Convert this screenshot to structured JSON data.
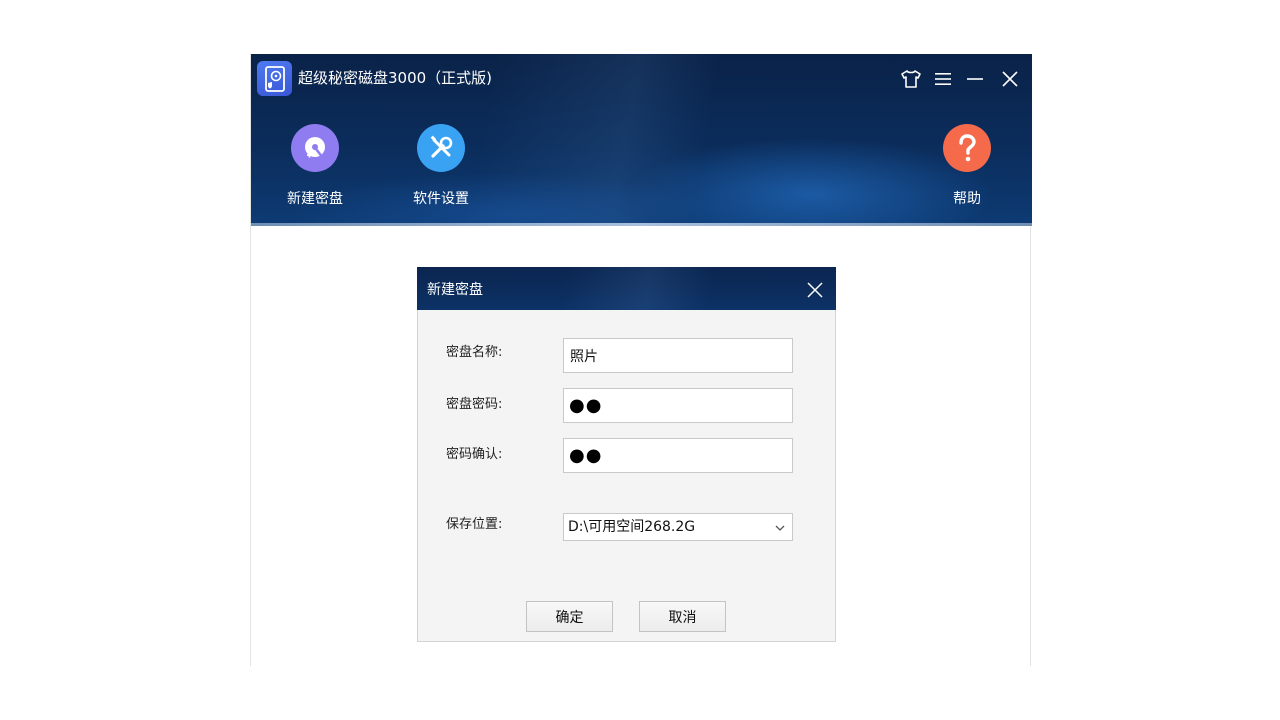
{
  "window": {
    "title": "超级秘密磁盘3000（正式版)"
  },
  "window_controls": {
    "skin_icon": "tshirt-icon",
    "menu_icon": "hamburger-menu-icon",
    "minimize_icon": "minimize-icon",
    "close_icon": "close-icon"
  },
  "toolbar": {
    "new_disk": {
      "label": "新建密盘",
      "icon": "disk-add-icon",
      "color": "#8f7cf0"
    },
    "settings": {
      "label": "软件设置",
      "icon": "wrench-screwdriver-icon",
      "color": "#3aa2f2"
    },
    "help": {
      "label": "帮助",
      "icon": "question-mark-icon",
      "color": "#f46a4a"
    }
  },
  "dialog": {
    "title": "新建密盘",
    "fields": {
      "name": {
        "label": "密盘名称:",
        "value": "照片"
      },
      "password": {
        "label": "密盘密码:",
        "value": "●●"
      },
      "confirm": {
        "label": "密码确认:",
        "value": "●●"
      },
      "location": {
        "label": "保存位置:",
        "value": "D:\\可用空间268.2G"
      }
    },
    "buttons": {
      "ok": "确定",
      "cancel": "取消"
    }
  }
}
